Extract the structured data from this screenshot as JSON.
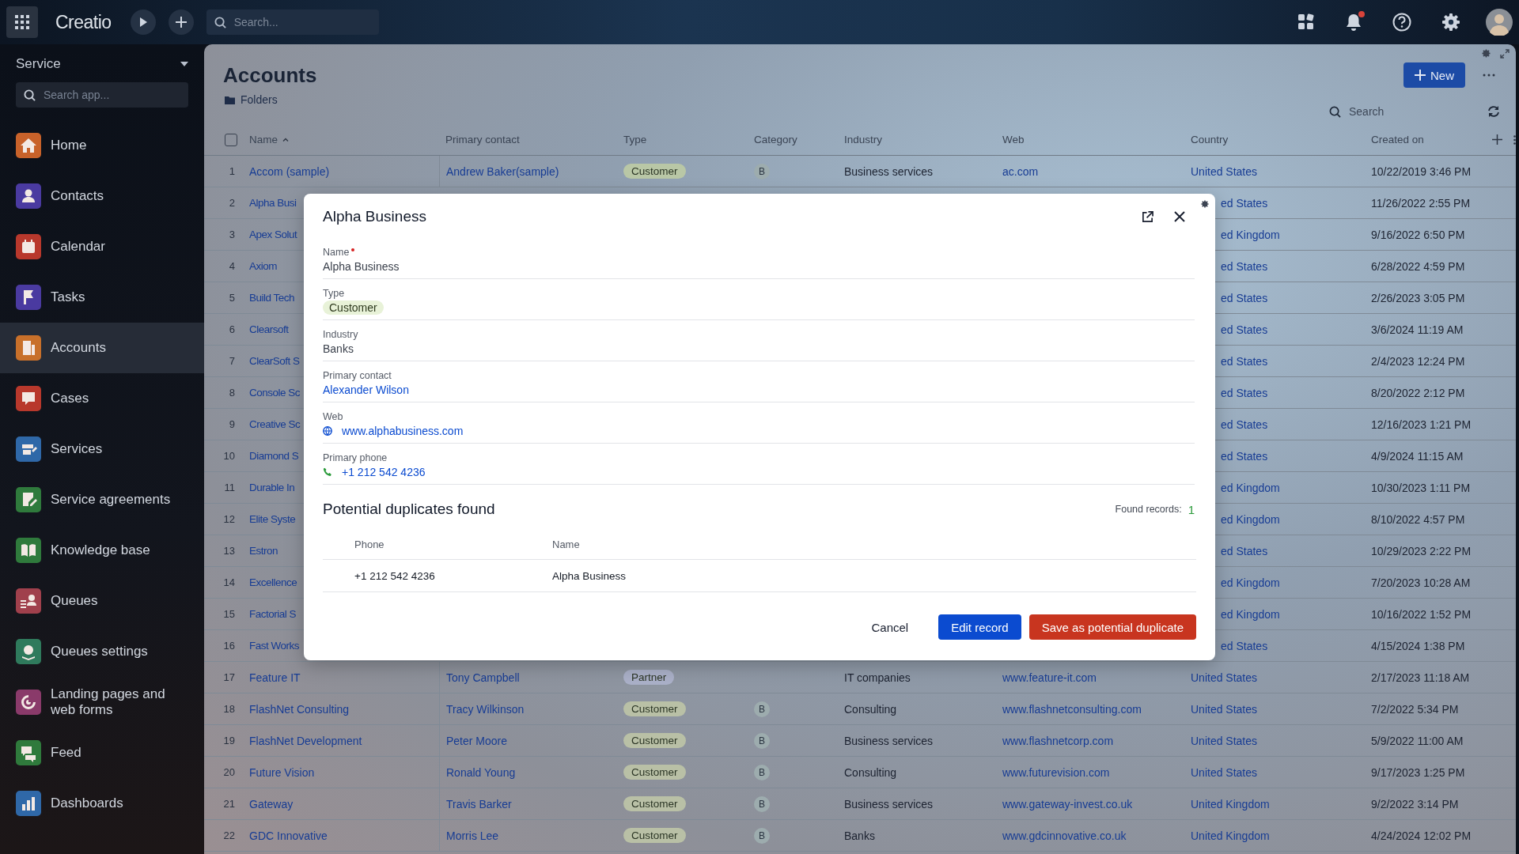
{
  "topbar": {
    "logo": "Creatio",
    "search": {
      "placeholder": "Search..."
    },
    "notifications": true
  },
  "sidebar": {
    "workplace": "Service",
    "search": {
      "placeholder": "Search app..."
    },
    "items": [
      {
        "label": "Home",
        "kind": "home",
        "color": "#c8622a",
        "selected": false
      },
      {
        "label": "Contacts",
        "kind": "contact",
        "color": "#4a3aa0",
        "selected": false
      },
      {
        "label": "Calendar",
        "kind": "calendar",
        "color": "#b8382c",
        "selected": false
      },
      {
        "label": "Tasks",
        "kind": "flag",
        "color": "#4a3aa0",
        "selected": false
      },
      {
        "label": "Accounts",
        "kind": "building",
        "color": "#c8702a",
        "selected": true
      },
      {
        "label": "Cases",
        "kind": "alert",
        "color": "#b8382c",
        "selected": false
      },
      {
        "label": "Services",
        "kind": "services",
        "color": "#2f68a8",
        "selected": false
      },
      {
        "label": "Service agreements",
        "kind": "agreement",
        "color": "#2f7a3c",
        "selected": false
      },
      {
        "label": "Knowledge base",
        "kind": "book",
        "color": "#2f7a3c",
        "selected": false
      },
      {
        "label": "Queues",
        "kind": "queue",
        "color": "#a0404c",
        "selected": false
      },
      {
        "label": "Queues settings",
        "kind": "gear",
        "color": "#2f7a5c",
        "selected": false
      },
      {
        "label": "Landing pages and web forms",
        "kind": "target",
        "color": "#8a3a6a",
        "selected": false
      },
      {
        "label": "Feed",
        "kind": "feed",
        "color": "#2f7a3c",
        "selected": false
      },
      {
        "label": "Dashboards",
        "kind": "chart",
        "color": "#2f68a8",
        "selected": false
      }
    ]
  },
  "page": {
    "title": "Accounts",
    "folders": "Folders",
    "new_button": "New",
    "search": {
      "placeholder": "Search"
    }
  },
  "table": {
    "select_all": {
      "checked": false
    },
    "columns": [
      {
        "label": "Name",
        "sorted": true
      },
      {
        "label": "Primary contact",
        "sorted": false
      },
      {
        "label": "Type",
        "sorted": false
      },
      {
        "label": "Category",
        "sorted": false
      },
      {
        "label": "Industry",
        "sorted": false
      },
      {
        "label": "Web",
        "sorted": false
      },
      {
        "label": "Country",
        "sorted": false
      },
      {
        "label": "Created on",
        "sorted": false
      }
    ],
    "rows": [
      {
        "num": "1",
        "name": "Accom (sample)",
        "contact": "Andrew Baker(sample)",
        "type": {
          "label": "Customer",
          "color": "#b9c7a6"
        },
        "category": "B",
        "industry": "Business services",
        "web": "ac.com",
        "country": "United States",
        "created": "10/22/2019 3:46 PM"
      },
      {
        "num": "2",
        "name": "Alpha Busi",
        "country": "ed States",
        "created": "11/26/2022 2:55 PM"
      },
      {
        "num": "3",
        "name": "Apex Solut",
        "country": "ed Kingdom",
        "created": "9/16/2022 6:50 PM"
      },
      {
        "num": "4",
        "name": "Axiom",
        "country": "ed States",
        "created": "6/28/2022 4:59 PM"
      },
      {
        "num": "5",
        "name": "Build Tech",
        "country": "ed States",
        "created": "2/26/2023 3:05 PM"
      },
      {
        "num": "6",
        "name": "Clearsoft",
        "country": "ed States",
        "created": "3/6/2024 11:19 AM"
      },
      {
        "num": "7",
        "name": "ClearSoft S",
        "country": "ed States",
        "created": "2/4/2023 12:24 PM"
      },
      {
        "num": "8",
        "name": "Console Sc",
        "country": "ed States",
        "created": "8/20/2022 2:12 PM"
      },
      {
        "num": "9",
        "name": "Creative Sc",
        "country": "ed States",
        "created": "12/16/2023 1:21 PM"
      },
      {
        "num": "10",
        "name": "Diamond S",
        "country": "ed States",
        "created": "4/9/2024 11:15 AM"
      },
      {
        "num": "11",
        "name": "Durable In",
        "country": "ed Kingdom",
        "created": "10/30/2023 1:11 PM"
      },
      {
        "num": "12",
        "name": "Elite Syste",
        "country": "ed Kingdom",
        "created": "8/10/2022 4:57 PM"
      },
      {
        "num": "13",
        "name": "Estron",
        "country": "ed States",
        "created": "10/29/2023 2:22 PM"
      },
      {
        "num": "14",
        "name": "Excellence",
        "country": "ed Kingdom",
        "created": "7/20/2023 10:28 AM"
      },
      {
        "num": "15",
        "name": "Factorial S",
        "country": "ed Kingdom",
        "created": "10/16/2022 1:52 PM"
      },
      {
        "num": "16",
        "name": "Fast Works",
        "country": "ed States",
        "created": "4/15/2024 1:38 PM"
      },
      {
        "num": "17",
        "name": "Feature IT",
        "contact": "Tony Campbell",
        "type": {
          "label": "Partner",
          "color": "#aab0c8"
        },
        "industry": "IT companies",
        "web": "www.feature-it.com",
        "country": "United States",
        "created": "2/17/2023 11:18 AM"
      },
      {
        "num": "18",
        "name": "FlashNet Consulting",
        "contact": "Tracy Wilkinson",
        "type": {
          "label": "Customer",
          "color": "#b9c0a6"
        },
        "category": "B",
        "industry": "Consulting",
        "web": "www.flashnetconsulting.com",
        "country": "United States",
        "created": "7/2/2022 5:34 PM"
      },
      {
        "num": "19",
        "name": "FlashNet Development",
        "contact": "Peter Moore",
        "type": {
          "label": "Customer",
          "color": "#b9c0a6"
        },
        "category": "B",
        "industry": "Business services",
        "web": "www.flashnetcorp.com",
        "country": "United States",
        "created": "5/9/2022 11:00 AM"
      },
      {
        "num": "20",
        "name": "Future Vision",
        "contact": "Ronald Young",
        "type": {
          "label": "Customer",
          "color": "#b9c0a6"
        },
        "category": "B",
        "industry": "Consulting",
        "web": "www.futurevision.com",
        "country": "United States",
        "created": "9/17/2023 1:25 PM"
      },
      {
        "num": "21",
        "name": "Gateway",
        "contact": "Travis Barker",
        "type": {
          "label": "Customer",
          "color": "#b9c0a6"
        },
        "category": "B",
        "industry": "Business services",
        "web": "www.gateway-invest.co.uk",
        "country": "United Kingdom",
        "created": "9/2/2022 3:14 PM"
      },
      {
        "num": "22",
        "name": "GDC Innovative",
        "contact": "Morris Lee",
        "type": {
          "label": "Customer",
          "color": "#b9c0a6"
        },
        "category": "B",
        "industry": "Banks",
        "web": "www.gdcinnovative.co.uk",
        "country": "United Kingdom",
        "created": "4/24/2024 12:02 PM"
      }
    ]
  },
  "modal": {
    "title": "Alpha Business",
    "fields": [
      {
        "label": "Name",
        "required": true,
        "kind": "text",
        "value": "Alpha Business"
      },
      {
        "label": "Type",
        "required": false,
        "kind": "tag",
        "value": "Customer"
      },
      {
        "label": "Industry",
        "required": false,
        "kind": "text",
        "value": "Banks"
      },
      {
        "label": "Primary contact",
        "required": false,
        "kind": "link",
        "value": "Alexander Wilson"
      },
      {
        "label": "Web",
        "required": false,
        "kind": "web",
        "value": "www.alphabusiness.com"
      },
      {
        "label": "Primary phone",
        "required": false,
        "kind": "phone",
        "value": "+1 212 542 4236"
      }
    ],
    "duplicates": {
      "title": "Potential duplicates found",
      "found_label": "Found records:",
      "found_count": "1",
      "columns": [
        "Phone",
        "Name"
      ],
      "rows": [
        [
          "+1 212 542 4236",
          "Alpha Business"
        ]
      ]
    },
    "buttons": [
      {
        "label": "Cancel",
        "kind": "plain"
      },
      {
        "label": "Edit record",
        "kind": "primary"
      },
      {
        "label": "Save as potential duplicate",
        "kind": "danger"
      }
    ]
  }
}
